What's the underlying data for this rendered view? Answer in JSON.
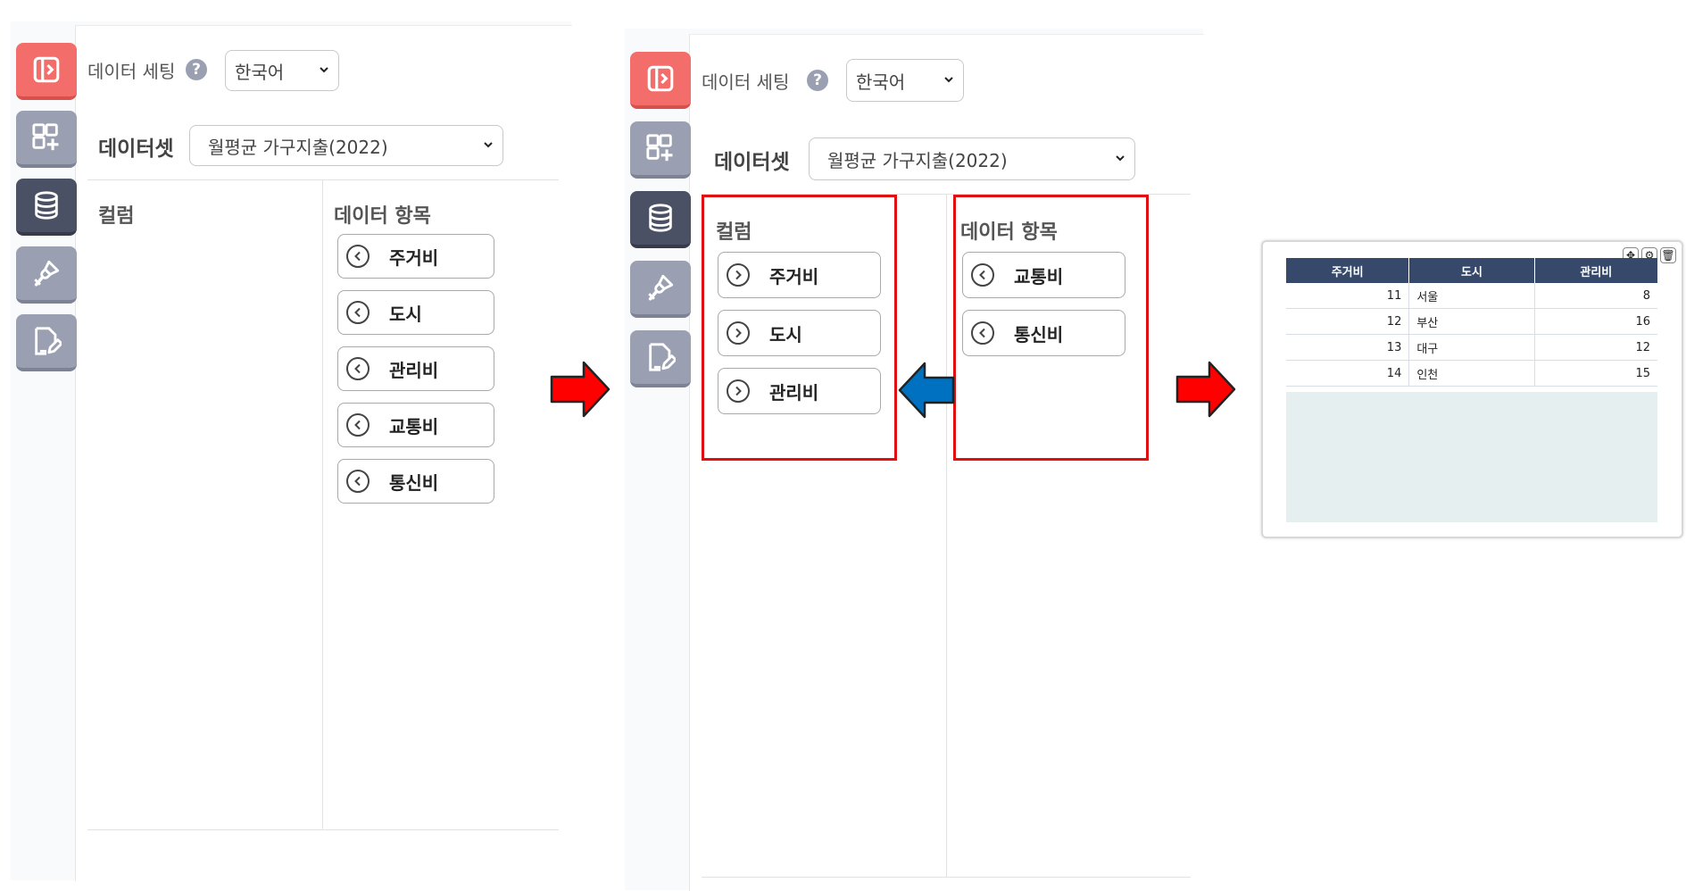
{
  "panel1": {
    "language_label": "데이터 세팅",
    "help_glyph": "?",
    "language_value": "한국어",
    "dataset_label": "데이터셋",
    "dataset_value": "월평균 가구지출(2022)",
    "column_title": "컬럼",
    "data_title": "데이터 항목",
    "data_items": [
      "주거비",
      "도시",
      "관리비",
      "교통비",
      "통신비"
    ]
  },
  "panel2": {
    "language_label": "데이터 세팅",
    "help_glyph": "?",
    "language_value": "한국어",
    "dataset_label": "데이터셋",
    "dataset_value": "월평균 가구지출(2022)",
    "column_title": "컬럼",
    "data_title": "데이터 항목",
    "column_items": [
      "주거비",
      "도시",
      "관리비"
    ],
    "data_items": [
      "교통비",
      "통신비"
    ]
  },
  "sidebar_icons": [
    "panel-toggle-icon",
    "add-widget-icon",
    "database-icon",
    "brush-icon",
    "edit-document-icon"
  ],
  "colors": {
    "accent_red": "#f36e6b",
    "sidebar_gray": "#9aa0b2",
    "sidebar_active": "#4b5164",
    "highlight_box": "#e01010",
    "arrow_red": "#ff0000",
    "arrow_blue": "#0070c0",
    "table_header": "#37496a"
  },
  "widget": {
    "tools": [
      "✥",
      "⚙",
      "🗑"
    ],
    "table": {
      "headers": [
        "주거비",
        "도시",
        "관리비"
      ],
      "rows": [
        [
          "11",
          "서울",
          "8"
        ],
        [
          "12",
          "부산",
          "16"
        ],
        [
          "13",
          "대구",
          "12"
        ],
        [
          "14",
          "인천",
          "15"
        ]
      ]
    }
  }
}
